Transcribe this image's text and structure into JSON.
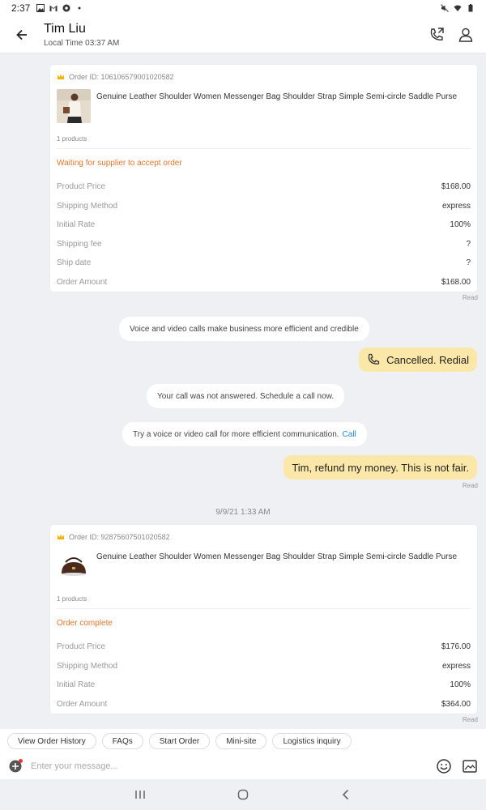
{
  "status_bar": {
    "time": "2:37"
  },
  "header": {
    "title": "Tim Liu",
    "subtitle": "Local Time 03:37 AM"
  },
  "orders": [
    {
      "order_id": "Order ID: 106106579001020582",
      "product_title": "Genuine Leather Shoulder Women Messenger Bag Shoulder Strap Simple Semi-circle Saddle Purse",
      "count": "1 products",
      "status": "Waiting for supplier to accept order",
      "rows": [
        {
          "label": "Product Price",
          "value": "$168.00"
        },
        {
          "label": "Shipping Method",
          "value": "express"
        },
        {
          "label": "Initial Rate",
          "value": "100%"
        },
        {
          "label": "Shipping fee",
          "value": "?"
        },
        {
          "label": "Ship date",
          "value": "?"
        },
        {
          "label": "Order Amount",
          "value": "$168.00"
        }
      ],
      "read": "Read"
    },
    {
      "order_id": "Order ID: 92875607501020582",
      "product_title": "Genuine Leather Shoulder Women Messenger Bag Shoulder Strap Simple Semi-circle Saddle Purse",
      "count": "1 products",
      "status": "Order complete",
      "rows": [
        {
          "label": "Product Price",
          "value": "$176.00"
        },
        {
          "label": "Shipping Method",
          "value": "express"
        },
        {
          "label": "Initial Rate",
          "value": "100%"
        },
        {
          "label": "Order Amount",
          "value": "$364.00"
        }
      ],
      "read": "Read"
    }
  ],
  "messages": {
    "sys_voice": "Voice and video calls make business more efficient and credible",
    "bubble_cancelled": "Cancelled. Redial",
    "sys_not_answered": "Your call was not answered. Schedule a call now.",
    "sys_try_call": "Try a voice or video call for more efficient communication.",
    "sys_try_call_link": "Call",
    "bubble_refund": "Tim, refund my money. This is not fair.",
    "bubble_refund_read": "Read",
    "date_separator": "9/9/21 1:33 AM"
  },
  "quick_replies": [
    "View Order History",
    "FAQs",
    "Start Order",
    "Mini-site",
    "Logistics inquiry"
  ],
  "input": {
    "placeholder": "Enter your message..."
  },
  "colors": {
    "accent_orange": "#e8762c",
    "bubble_yellow": "#fbe7a8",
    "link_blue": "#1e88e5"
  }
}
